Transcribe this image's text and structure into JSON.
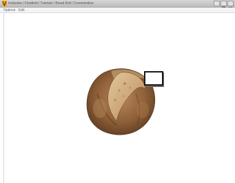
{
  "window": {
    "title": "Instaview / Flowfield / Tutorials / Bread Roll / Coverwindow",
    "buttons": [
      "minimize",
      "maximize",
      "close"
    ]
  },
  "menu": {
    "items": [
      "Options",
      "Edit"
    ]
  },
  "canvas": {
    "background": "#ffffff",
    "object": "bread-roll-image",
    "label_box_text": ""
  },
  "colors": {
    "titlebar": "#c8c8c8",
    "bread_crust": "#8a5c34",
    "bread_crumb": "#d5b389"
  }
}
